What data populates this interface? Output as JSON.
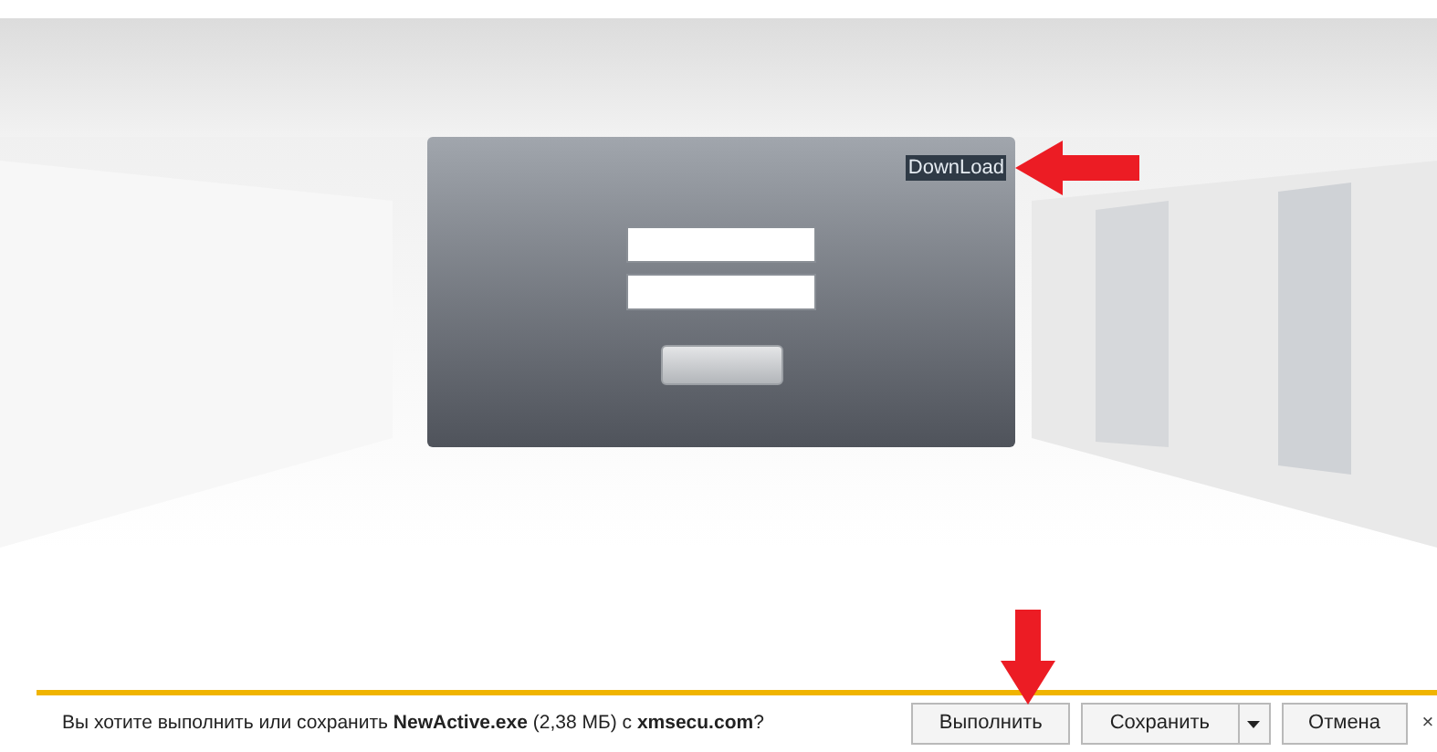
{
  "login_panel": {
    "download_link": {
      "label": "DownLoad",
      "selected": true
    }
  },
  "download_bar": {
    "message": "Вы хотите выполнить или сохранить **NewActive.exe** (2,38 МБ) с **xmsecu.com**?",
    "buttons": [
      {
        "label": "Выполнить",
        "has_menu": false
      },
      {
        "label": "Сохранить",
        "has_menu": true
      },
      {
        "label": "Отмена",
        "has_menu": false
      }
    ],
    "close": "×"
  }
}
